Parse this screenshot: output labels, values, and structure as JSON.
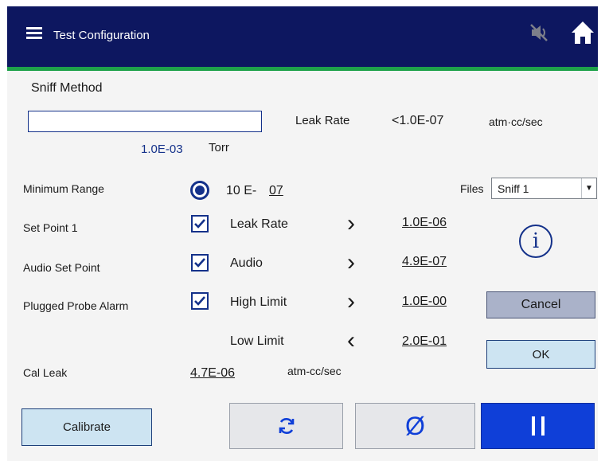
{
  "header": {
    "title": "Test Configuration",
    "menu_icon": "hamburger-menu-icon",
    "mute_icon": "speaker-muted-icon",
    "home_icon": "home-icon"
  },
  "method": {
    "label": "Sniff Method",
    "pressure_value": "1.0E-03",
    "pressure_unit": "Torr",
    "leak_rate_label": "Leak Rate",
    "leak_rate_value": "<1.0E-07",
    "leak_rate_unit": "atm·cc/sec"
  },
  "settings": {
    "minimum_range_label": "Minimum Range",
    "minimum_range_prefix": "10 E-",
    "minimum_range_exponent": "07",
    "set_point_1_label": "Set Point 1",
    "audio_set_point_label": "Audio Set Point",
    "plugged_probe_alarm_label": "Plugged Probe Alarm",
    "cal_leak_label": "Cal Leak",
    "cal_leak_value": "4.7E-06",
    "cal_leak_unit": "atm-cc/sec"
  },
  "limits": [
    {
      "label": "Leak Rate",
      "symbol": "›",
      "value": "1.0E-06",
      "checked": true
    },
    {
      "label": "Audio",
      "symbol": "›",
      "value": "4.9E-07",
      "checked": true
    },
    {
      "label": "High Limit",
      "symbol": "›",
      "value": "1.0E-00",
      "checked": true
    },
    {
      "label": "Low Limit",
      "symbol": "‹",
      "value": "2.0E-01"
    }
  ],
  "files": {
    "label": "Files",
    "selected": "Sniff 1"
  },
  "buttons": {
    "cancel": "Cancel",
    "ok": "OK",
    "calibrate": "Calibrate"
  },
  "icons": {
    "info": "i",
    "refresh": "refresh-icon",
    "null": "Ø",
    "pause": "pause-icon"
  },
  "colors": {
    "header": "#0d1760",
    "accent_line": "#1ea24a",
    "primary_blue": "#0f3fd8",
    "text_blue": "#14318a"
  }
}
